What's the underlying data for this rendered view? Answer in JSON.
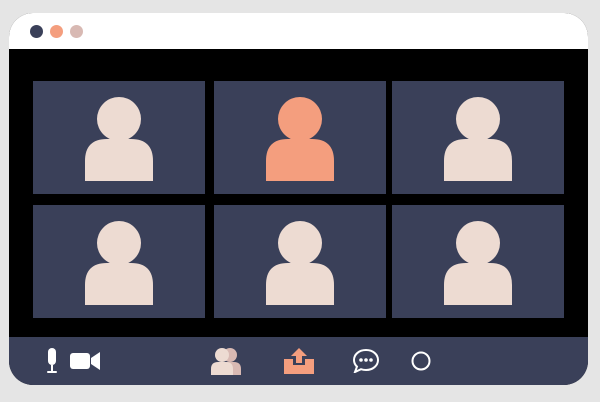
{
  "window": {
    "frame_color": "#000000",
    "titlebar_color": "#ffffff",
    "traffic_lights": [
      {
        "name": "close",
        "color": "#3a4059"
      },
      {
        "name": "minimize",
        "color": "#f49e7e"
      },
      {
        "name": "maximize",
        "color": "#d8b9b3"
      }
    ]
  },
  "grid": {
    "tile_color": "#3a4059",
    "participants": [
      {
        "state": "idle",
        "color": "#eddbd2"
      },
      {
        "state": "active-speaker",
        "color": "#f49e7e"
      },
      {
        "state": "idle",
        "color": "#eddbd2"
      },
      {
        "state": "idle",
        "color": "#eddbd2"
      },
      {
        "state": "idle",
        "color": "#eddbd2"
      },
      {
        "state": "idle",
        "color": "#eddbd2"
      }
    ]
  },
  "toolbar": {
    "background": "#3a4059",
    "buttons": [
      {
        "icon": "microphone-icon",
        "color": "#ffffff"
      },
      {
        "icon": "video-camera-icon",
        "color": "#ffffff"
      },
      {
        "icon": "participants-icon",
        "color": "#eddbd2"
      },
      {
        "icon": "share-screen-icon",
        "color": "#f49e7e"
      },
      {
        "icon": "chat-icon",
        "color": "#ffffff"
      },
      {
        "icon": "record-icon",
        "color": "#ffffff"
      }
    ]
  }
}
